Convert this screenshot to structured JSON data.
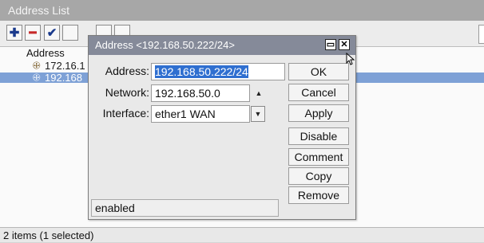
{
  "window": {
    "title": "Address List"
  },
  "toolbar": {
    "add_icon": "plus-icon",
    "remove_icon": "minus-icon",
    "enable_icon": "check-icon"
  },
  "list": {
    "column_address": "Address",
    "rows": [
      {
        "address": "172.16.1",
        "selected": false
      },
      {
        "address": "192.168",
        "selected": true
      }
    ]
  },
  "status_bar": "2 items (1 selected)",
  "dialog": {
    "title": "Address <192.168.50.222/24>",
    "address_label": "Address:",
    "address_value": "192.168.50.222/24",
    "network_label": "Network:",
    "network_value": "192.168.50.0",
    "interface_label": "Interface:",
    "interface_value": "ether1 WAN",
    "buttons": {
      "ok": "OK",
      "cancel": "Cancel",
      "apply": "Apply",
      "disable": "Disable",
      "comment": "Comment",
      "copy": "Copy",
      "remove": "Remove"
    },
    "status": "enabled"
  },
  "colors": {
    "selection": "#7ea1d6",
    "dialog_title_bg": "#858a99",
    "add_icon": "#1a3a8c",
    "remove_icon": "#c62828",
    "check_icon": "#1a3a8c"
  }
}
